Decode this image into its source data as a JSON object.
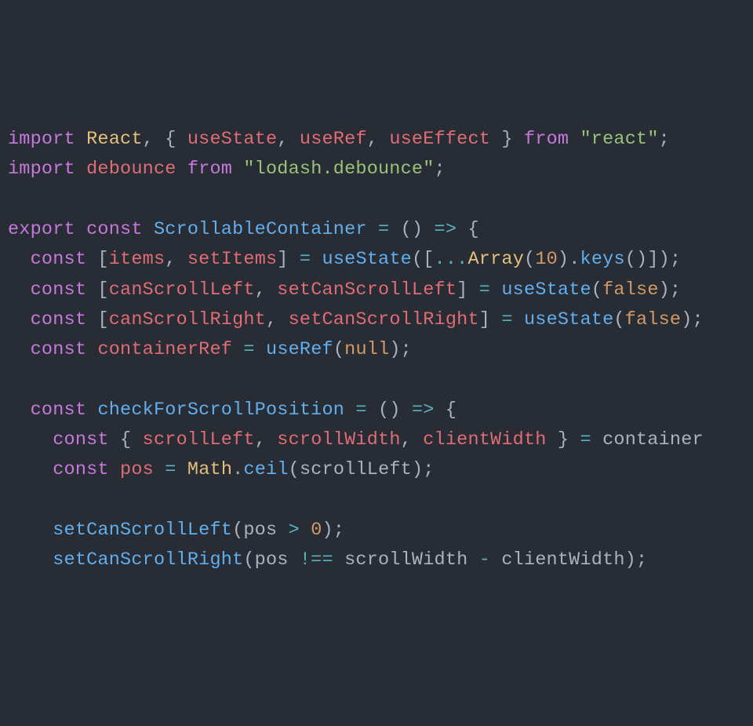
{
  "code": {
    "lines": [
      [
        {
          "t": "import ",
          "c": "kw"
        },
        {
          "t": "React",
          "c": "id"
        },
        {
          "t": ", { ",
          "c": "pn"
        },
        {
          "t": "useState",
          "c": "varn"
        },
        {
          "t": ", ",
          "c": "pn"
        },
        {
          "t": "useRef",
          "c": "varn"
        },
        {
          "t": ", ",
          "c": "pn"
        },
        {
          "t": "useEffect",
          "c": "varn"
        },
        {
          "t": " } ",
          "c": "pn"
        },
        {
          "t": "from ",
          "c": "kw"
        },
        {
          "t": "\"react\"",
          "c": "str"
        },
        {
          "t": ";",
          "c": "pn"
        }
      ],
      [
        {
          "t": "import ",
          "c": "kw"
        },
        {
          "t": "debounce",
          "c": "varn"
        },
        {
          "t": " ",
          "c": "pn"
        },
        {
          "t": "from ",
          "c": "kw"
        },
        {
          "t": "\"lodash.debounce\"",
          "c": "str"
        },
        {
          "t": ";",
          "c": "pn"
        }
      ],
      [
        {
          "t": " ",
          "c": "pn"
        }
      ],
      [
        {
          "t": "export ",
          "c": "kw"
        },
        {
          "t": "const ",
          "c": "kw"
        },
        {
          "t": "ScrollableContainer",
          "c": "fn"
        },
        {
          "t": " ",
          "c": "pn"
        },
        {
          "t": "=",
          "c": "op"
        },
        {
          "t": " () ",
          "c": "pn"
        },
        {
          "t": "=>",
          "c": "op"
        },
        {
          "t": " {",
          "c": "pn"
        }
      ],
      [
        {
          "t": "  ",
          "c": "pn"
        },
        {
          "t": "const ",
          "c": "kw"
        },
        {
          "t": "[",
          "c": "pn"
        },
        {
          "t": "items",
          "c": "varn"
        },
        {
          "t": ", ",
          "c": "pn"
        },
        {
          "t": "setItems",
          "c": "varn"
        },
        {
          "t": "] ",
          "c": "pn"
        },
        {
          "t": "=",
          "c": "op"
        },
        {
          "t": " ",
          "c": "pn"
        },
        {
          "t": "useState",
          "c": "call"
        },
        {
          "t": "([",
          "c": "pn"
        },
        {
          "t": "...",
          "c": "op"
        },
        {
          "t": "Array",
          "c": "id"
        },
        {
          "t": "(",
          "c": "pn"
        },
        {
          "t": "10",
          "c": "num"
        },
        {
          "t": ").",
          "c": "pn"
        },
        {
          "t": "keys",
          "c": "call"
        },
        {
          "t": "()]);",
          "c": "pn"
        }
      ],
      [
        {
          "t": "  ",
          "c": "pn"
        },
        {
          "t": "const ",
          "c": "kw"
        },
        {
          "t": "[",
          "c": "pn"
        },
        {
          "t": "canScrollLeft",
          "c": "varn"
        },
        {
          "t": ", ",
          "c": "pn"
        },
        {
          "t": "setCanScrollLeft",
          "c": "varn"
        },
        {
          "t": "] ",
          "c": "pn"
        },
        {
          "t": "=",
          "c": "op"
        },
        {
          "t": " ",
          "c": "pn"
        },
        {
          "t": "useState",
          "c": "call"
        },
        {
          "t": "(",
          "c": "pn"
        },
        {
          "t": "false",
          "c": "bool"
        },
        {
          "t": ");",
          "c": "pn"
        }
      ],
      [
        {
          "t": "  ",
          "c": "pn"
        },
        {
          "t": "const ",
          "c": "kw"
        },
        {
          "t": "[",
          "c": "pn"
        },
        {
          "t": "canScrollRight",
          "c": "varn"
        },
        {
          "t": ", ",
          "c": "pn"
        },
        {
          "t": "setCanScrollRight",
          "c": "varn"
        },
        {
          "t": "] ",
          "c": "pn"
        },
        {
          "t": "=",
          "c": "op"
        },
        {
          "t": " ",
          "c": "pn"
        },
        {
          "t": "useState",
          "c": "call"
        },
        {
          "t": "(",
          "c": "pn"
        },
        {
          "t": "false",
          "c": "bool"
        },
        {
          "t": ");",
          "c": "pn"
        }
      ],
      [
        {
          "t": "  ",
          "c": "pn"
        },
        {
          "t": "const ",
          "c": "kw"
        },
        {
          "t": "containerRef",
          "c": "varn"
        },
        {
          "t": " ",
          "c": "pn"
        },
        {
          "t": "=",
          "c": "op"
        },
        {
          "t": " ",
          "c": "pn"
        },
        {
          "t": "useRef",
          "c": "call"
        },
        {
          "t": "(",
          "c": "pn"
        },
        {
          "t": "null",
          "c": "bool"
        },
        {
          "t": ");",
          "c": "pn"
        }
      ],
      [
        {
          "t": " ",
          "c": "pn"
        }
      ],
      [
        {
          "t": "  ",
          "c": "pn"
        },
        {
          "t": "const ",
          "c": "kw"
        },
        {
          "t": "checkForScrollPosition",
          "c": "fn"
        },
        {
          "t": " ",
          "c": "pn"
        },
        {
          "t": "=",
          "c": "op"
        },
        {
          "t": " () ",
          "c": "pn"
        },
        {
          "t": "=>",
          "c": "op"
        },
        {
          "t": " {",
          "c": "pn"
        }
      ],
      [
        {
          "t": "    ",
          "c": "pn"
        },
        {
          "t": "const ",
          "c": "kw"
        },
        {
          "t": "{ ",
          "c": "pn"
        },
        {
          "t": "scrollLeft",
          "c": "varn"
        },
        {
          "t": ", ",
          "c": "pn"
        },
        {
          "t": "scrollWidth",
          "c": "varn"
        },
        {
          "t": ", ",
          "c": "pn"
        },
        {
          "t": "clientWidth",
          "c": "varn"
        },
        {
          "t": " } ",
          "c": "pn"
        },
        {
          "t": "=",
          "c": "op"
        },
        {
          "t": " container",
          "c": "def"
        }
      ],
      [
        {
          "t": "    ",
          "c": "pn"
        },
        {
          "t": "const ",
          "c": "kw"
        },
        {
          "t": "pos",
          "c": "varn"
        },
        {
          "t": " ",
          "c": "pn"
        },
        {
          "t": "=",
          "c": "op"
        },
        {
          "t": " ",
          "c": "pn"
        },
        {
          "t": "Math",
          "c": "id"
        },
        {
          "t": ".",
          "c": "pn"
        },
        {
          "t": "ceil",
          "c": "call"
        },
        {
          "t": "(scrollLeft);",
          "c": "pn"
        }
      ],
      [
        {
          "t": " ",
          "c": "pn"
        }
      ],
      [
        {
          "t": "    ",
          "c": "pn"
        },
        {
          "t": "setCanScrollLeft",
          "c": "call"
        },
        {
          "t": "(pos ",
          "c": "pn"
        },
        {
          "t": ">",
          "c": "op"
        },
        {
          "t": " ",
          "c": "pn"
        },
        {
          "t": "0",
          "c": "num"
        },
        {
          "t": ");",
          "c": "pn"
        }
      ],
      [
        {
          "t": "    ",
          "c": "pn"
        },
        {
          "t": "setCanScrollRight",
          "c": "call"
        },
        {
          "t": "(pos ",
          "c": "pn"
        },
        {
          "t": "!==",
          "c": "op"
        },
        {
          "t": " scrollWidth ",
          "c": "pn"
        },
        {
          "t": "-",
          "c": "op"
        },
        {
          "t": " clientWidth);",
          "c": "pn"
        }
      ]
    ]
  }
}
